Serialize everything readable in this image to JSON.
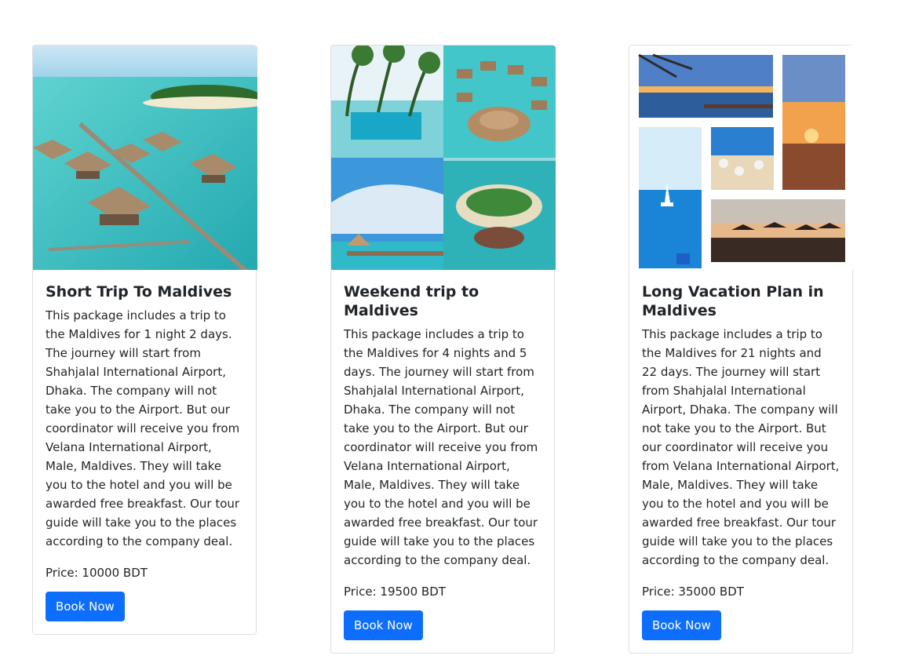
{
  "cards": [
    {
      "title": "Short Trip To Maldives",
      "description": "This package includes a trip to the Maldives for 1 night 2 days. The journey will start from Shahjalal International Airport, Dhaka. The company will not take you to the Airport. But our coordinator will receive you from Velana International Airport, Male, Maldives. They will take you to the hotel and you will be awarded free breakfast. Our tour guide will take you to the places according to the company deal.",
      "price": "Price: 10000 BDT",
      "button": "Book Now"
    },
    {
      "title": "Weekend trip to Maldives",
      "description": "This package includes a trip to the Maldives for 4 nights and 5 days. The journey will start from Shahjalal International Airport, Dhaka. The company will not take you to the Airport. But our coordinator will receive you from Velana International Airport, Male, Maldives. They will take you to the hotel and you will be awarded free breakfast. Our tour guide will take you to the places according to the company deal.",
      "price": "Price: 19500 BDT",
      "button": "Book Now"
    },
    {
      "title": "Long Vacation Plan in Maldives",
      "description": "This package includes a trip to the Maldives for 21 nights and 22 days. The journey will start from Shahjalal International Airport, Dhaka. The company will not take you to the Airport. But our coordinator will receive you from Velana International Airport, Male, Maldives. They will take you to the hotel and you will be awarded free breakfast. Our tour guide will take you to the places according to the company deal.",
      "price": "Price: 35000 BDT",
      "button": "Book Now"
    }
  ],
  "colors": {
    "primary": "#0d6efd",
    "text": "#212529"
  }
}
